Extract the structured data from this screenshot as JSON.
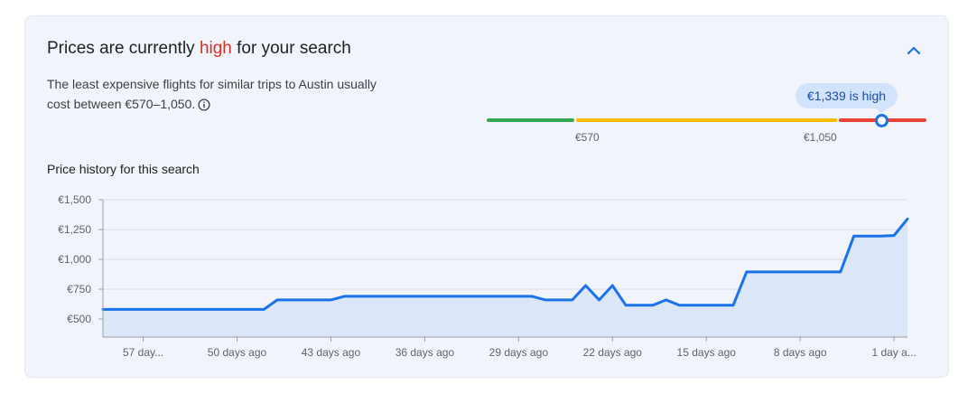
{
  "header": {
    "title_prefix": "Prices are currently ",
    "title_highlight": "high",
    "title_suffix": " for your search",
    "collapse_icon": "chevron-up-icon"
  },
  "summary": {
    "line1": "The least expensive flights for similar trips to Austin usually",
    "line2": "cost between €570–1,050.",
    "info_icon": "info-icon"
  },
  "price_range": {
    "low_label": "€570",
    "high_label": "€1,050",
    "current_label": "€1,339 is high",
    "colors": {
      "low": "#34a853",
      "typical": "#fbbc04",
      "high": "#ea4335",
      "marker": "#1a73e8"
    }
  },
  "history": {
    "title": "Price history for this search"
  },
  "chart_data": {
    "type": "area",
    "title": "",
    "xlabel": "",
    "ylabel": "",
    "ylim": [
      300,
      1500
    ],
    "yticks": [
      {
        "value": 500,
        "label": "€500"
      },
      {
        "value": 750,
        "label": "€750"
      },
      {
        "value": 1000,
        "label": "€1,000"
      },
      {
        "value": 1250,
        "label": "€1,250"
      },
      {
        "value": 1500,
        "label": "€1,500"
      }
    ],
    "xlim": [
      60,
      0
    ],
    "xticks": [
      {
        "value": 57,
        "label": "57 day..."
      },
      {
        "value": 50,
        "label": "50 days ago"
      },
      {
        "value": 43,
        "label": "43 days ago"
      },
      {
        "value": 36,
        "label": "36 days ago"
      },
      {
        "value": 29,
        "label": "29 days ago"
      },
      {
        "value": 22,
        "label": "22 days ago"
      },
      {
        "value": 15,
        "label": "15 days ago"
      },
      {
        "value": 8,
        "label": "8 days ago"
      },
      {
        "value": 1,
        "label": "1 day a..."
      }
    ],
    "grid": true,
    "series": [
      {
        "color": "#1a73e8",
        "fill": "#dbe6f8",
        "points": [
          [
            60,
            580
          ],
          [
            48,
            580
          ],
          [
            47,
            660
          ],
          [
            43,
            660
          ],
          [
            42,
            690
          ],
          [
            28,
            690
          ],
          [
            27,
            660
          ],
          [
            25,
            660
          ],
          [
            24,
            780
          ],
          [
            23,
            660
          ],
          [
            22,
            780
          ],
          [
            21,
            615
          ],
          [
            19,
            615
          ],
          [
            18,
            660
          ],
          [
            17,
            615
          ],
          [
            13,
            615
          ],
          [
            12,
            895
          ],
          [
            5,
            895
          ],
          [
            4,
            1195
          ],
          [
            2,
            1195
          ],
          [
            1,
            1200
          ],
          [
            0,
            1339
          ]
        ]
      }
    ]
  }
}
